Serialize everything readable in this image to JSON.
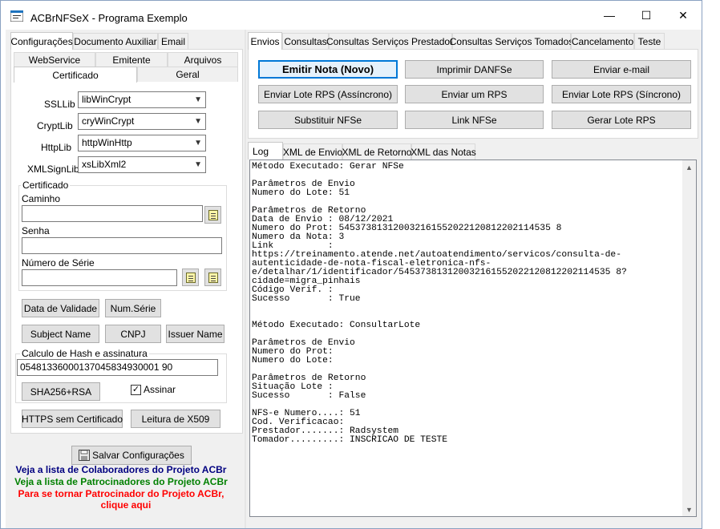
{
  "window": {
    "title": "ACBrNFSeX - Programa Exemplo",
    "minimize": "—",
    "maximize": "☐",
    "close": "✕"
  },
  "left_tabs": [
    "Configurações",
    "Documento Auxiliar",
    "Email"
  ],
  "config_tabs_row1": [
    "WebService",
    "Emitente",
    "Arquivos"
  ],
  "config_tabs_row2": [
    "Certificado",
    "Geral"
  ],
  "libs": [
    {
      "label": "SSLLib",
      "value": "libWinCrypt"
    },
    {
      "label": "CryptLib",
      "value": "cryWinCrypt"
    },
    {
      "label": "HttpLib",
      "value": "httpWinHttp"
    },
    {
      "label": "XMLSignLib",
      "value": "xsLibXml2"
    }
  ],
  "certificado": {
    "group_title": "Certificado",
    "caminho_label": "Caminho",
    "caminho_value": "",
    "senha_label": "Senha",
    "senha_value": "",
    "numserie_label": "Número de Série",
    "numserie_value": ""
  },
  "cert_buttons": [
    "Data de Validade",
    "Num.Série",
    "Subject Name",
    "CNPJ",
    "Issuer Name"
  ],
  "hash": {
    "group_title": "Calculo de Hash e assinatura",
    "value": "05481336000137045834930001 90",
    "sha_button": "SHA256+RSA",
    "assinar_label": "Assinar",
    "assinar_checked": "✓"
  },
  "bottom_buttons": [
    "HTTPS sem Certificado",
    "Leitura de X509"
  ],
  "save_button": "Salvar Configurações",
  "sponsors": {
    "colaboradores": "Veja a lista de Colaboradores do Projeto ACBr",
    "patrocinadores": "Veja a lista de Patrocinadores do Projeto ACBr",
    "tornar_line1": "Para se tornar Patrocinador do Projeto ACBr,",
    "tornar_line2": "clique aqui",
    "colors": {
      "colaboradores": "#000080",
      "patrocinadores": "#008000",
      "tornar": "#ff0000"
    }
  },
  "right_tabs": [
    "Envios",
    "Consultas",
    "Consultas Serviços Prestados",
    "Consultas Serviços Tomados",
    "Cancelamento",
    "Teste"
  ],
  "action_buttons": [
    "Emitir Nota (Novo)",
    "Imprimir DANFSe",
    "Enviar e-mail",
    "Enviar Lote RPS (Assíncrono)",
    "Enviar um RPS",
    "Enviar Lote RPS (Síncrono)",
    "Substituir NFSe",
    "Link NFSe",
    "Gerar Lote RPS"
  ],
  "log_tabs": [
    "Log",
    "XML de Envio",
    "XML de Retorno",
    "XML das Notas"
  ],
  "log_lines": [
    "Método Executado: Gerar NFSe",
    "",
    "Parâmetros de Envio",
    "Numero do Lote: 51",
    "",
    "Parâmetros de Retorno",
    "Data de Envio : 08/12/2021",
    "Numero do Prot: 545373813120032161552022120812202114535 8",
    "Numero da Nota: 3",
    "Link          :",
    "https://treinamento.atende.net/autoatendimento/servicos/consulta-de-",
    "autenticidade-de-nota-fiscal-eletronica-nfs-",
    "e/detalhar/1/identificador/545373813120032161552022120812202114535 8?",
    "cidade=migra_pinhais",
    "Código Verif. :",
    "Sucesso       : True",
    "",
    "",
    "Método Executado: ConsultarLote",
    "",
    "Parâmetros de Envio",
    "Numero do Prot:",
    "Numero do Lote:",
    "",
    "Parâmetros de Retorno",
    "Situação Lote :",
    "Sucesso       : False",
    "",
    "NFS-e Numero....: 51",
    "Cod. Verificacao:",
    "Prestador.......: Radsystem",
    "Tomador.........: INSCRICAO DE TESTE"
  ]
}
